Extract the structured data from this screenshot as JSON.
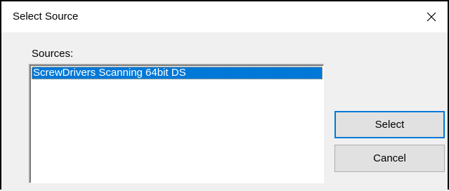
{
  "window": {
    "title": "Select Source",
    "close_glyph": "close-icon"
  },
  "sources": {
    "label": "Sources:",
    "items": [
      {
        "label": "ScrewDrivers Scanning 64bit DS",
        "selected": true
      }
    ]
  },
  "buttons": {
    "select_label": "Select",
    "cancel_label": "Cancel"
  },
  "colors": {
    "selection": "#0078d7",
    "button_face": "#e1e1e1",
    "dialog_background": "#f0f0f0"
  }
}
